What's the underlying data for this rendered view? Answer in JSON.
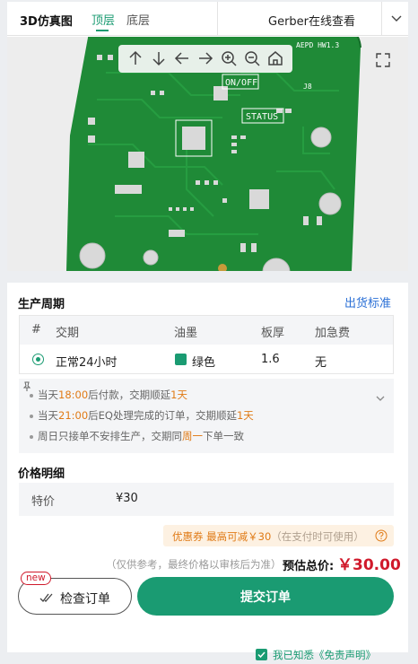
{
  "viewer": {
    "tabs": {
      "title": "3D仿真图",
      "top": "顶层",
      "bottom": "底层"
    },
    "gerber": {
      "label": "Gerber在线查看"
    },
    "pcb_labels": {
      "onoff": "ON/OFF",
      "status": "STATUS",
      "j8": "J8",
      "ver": "AEPD HW1.3"
    },
    "toolbar_icons": [
      "arrow-up-icon",
      "arrow-down-icon",
      "arrow-left-icon",
      "arrow-right-icon",
      "zoom-in-icon",
      "zoom-out-icon",
      "home-icon"
    ],
    "colors": {
      "pcb": "#1f8a37",
      "silk": "#ffffff",
      "pad": "#d9d9d9"
    }
  },
  "production": {
    "title": "生产周期",
    "shipping_link": "出货标准",
    "table": {
      "headers": [
        "#",
        "交期",
        "油墨",
        "板厚",
        "加急费"
      ],
      "row": {
        "delivery": "正常24小时",
        "ink": "绿色",
        "thickness": "1.6",
        "rush_fee": "无"
      }
    },
    "notes": [
      [
        "当天",
        "18:00",
        "后付款，交期顺延",
        "1天",
        ""
      ],
      [
        "当天",
        "21:00",
        "后EQ处理完成的订单，交期顺延",
        "1天",
        ""
      ],
      [
        "周日只接单不安排生产，交期同",
        "周一",
        "下单一致",
        "",
        ""
      ]
    ]
  },
  "price": {
    "title": "价格明细",
    "label": "特价",
    "value": "¥30",
    "coupon": {
      "main": "优惠券 最高可减￥30",
      "sub": "（在支付时可使用）"
    },
    "estimate_note": "（仅供参考，最终价格以审核后为准）",
    "estimate_label": "预估总价:",
    "estimate_value": "￥30.00"
  },
  "actions": {
    "check_label": "检查订单",
    "new_badge": "new",
    "submit_label": "提交订单",
    "agree_text": "我已知悉《免责声明》"
  },
  "colors": {
    "accent": "#1a9b72",
    "price": "#d0192b",
    "highlight": "#e07b17",
    "link": "#2a6fd6"
  }
}
